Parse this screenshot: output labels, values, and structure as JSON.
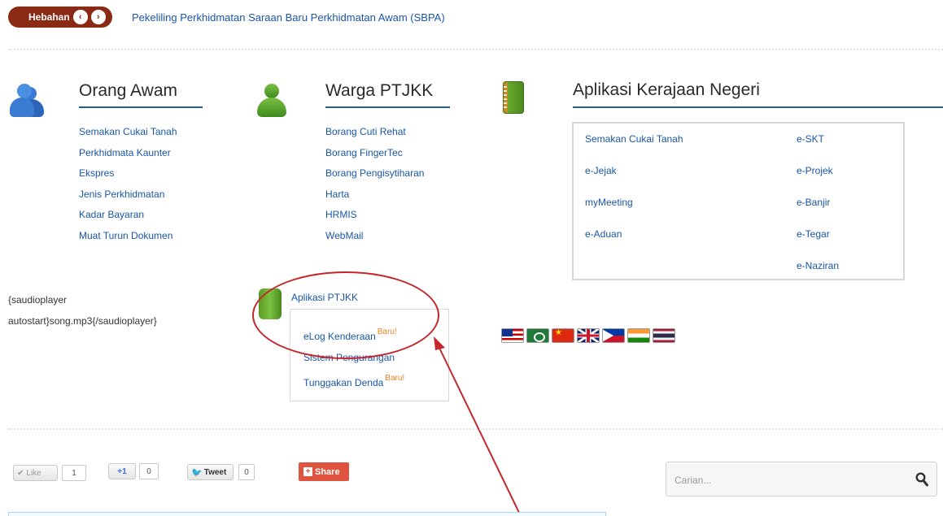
{
  "ticker": {
    "badge_label": "Hebahan",
    "prev_arrow": "‹",
    "next_arrow": "›",
    "headline": "Pekeliling Perkhidmatan Saraan Baru Perkhidmatan Awam (SBPA)"
  },
  "orang_awam": {
    "title": "Orang Awam",
    "icon": "users-icon",
    "links": [
      "Semakan Cukai Tanah",
      "Perkhidmata Kaunter",
      "Ekspres",
      "Jenis Perkhidmatan",
      "Kadar Bayaran",
      "Muat Turun Dokumen"
    ]
  },
  "warga": {
    "title": "Warga PTJKK",
    "icon": "user-icon",
    "links": [
      "Borang Cuti Rehat",
      "Borang FingerTec",
      "Borang Pengisytiharan",
      "Harta",
      "HRMIS",
      "WebMail"
    ]
  },
  "kerajaan": {
    "title": "Aplikasi Kerajaan Negeri",
    "icon": "notebook-icon",
    "left_links": [
      "Semakan Cukai Tanah",
      "e-Jejak",
      "myMeeting",
      "e-Aduan"
    ],
    "right_links": [
      "e-SKT",
      "e-Projek",
      "e-Banjir",
      "e-Tegar",
      "e-Naziran"
    ]
  },
  "audioplayer": {
    "line1": "{saudioplayer",
    "line2": "autostart}song.mp3{/saudioplayer}"
  },
  "ptjkk": {
    "title": "Aplikasi PTJKK",
    "badge": "Baru!",
    "items": [
      "eLog Kenderaan",
      "Sistem Pengurangan",
      "Tunggakan Denda"
    ]
  },
  "flags": [
    "Bahasa Melayu",
    "Arabic",
    "Chinese",
    "English",
    "Filipino",
    "Hindi",
    "Thai"
  ],
  "social": {
    "like_label": "Like",
    "like_count": "1",
    "plusone_label": "+1",
    "plusone_count": "0",
    "tweet_label": "Tweet",
    "tweet_count": "0",
    "share_label": "Share"
  },
  "search": {
    "placeholder": "Carian..."
  },
  "colors": {
    "link": "#1a56a8",
    "ticker_badge": "#8b2a14",
    "heading_rule": "#1e5f99",
    "badge_new": "#f07f1a",
    "annotation": "#c4262e",
    "share": "#e0533e"
  }
}
